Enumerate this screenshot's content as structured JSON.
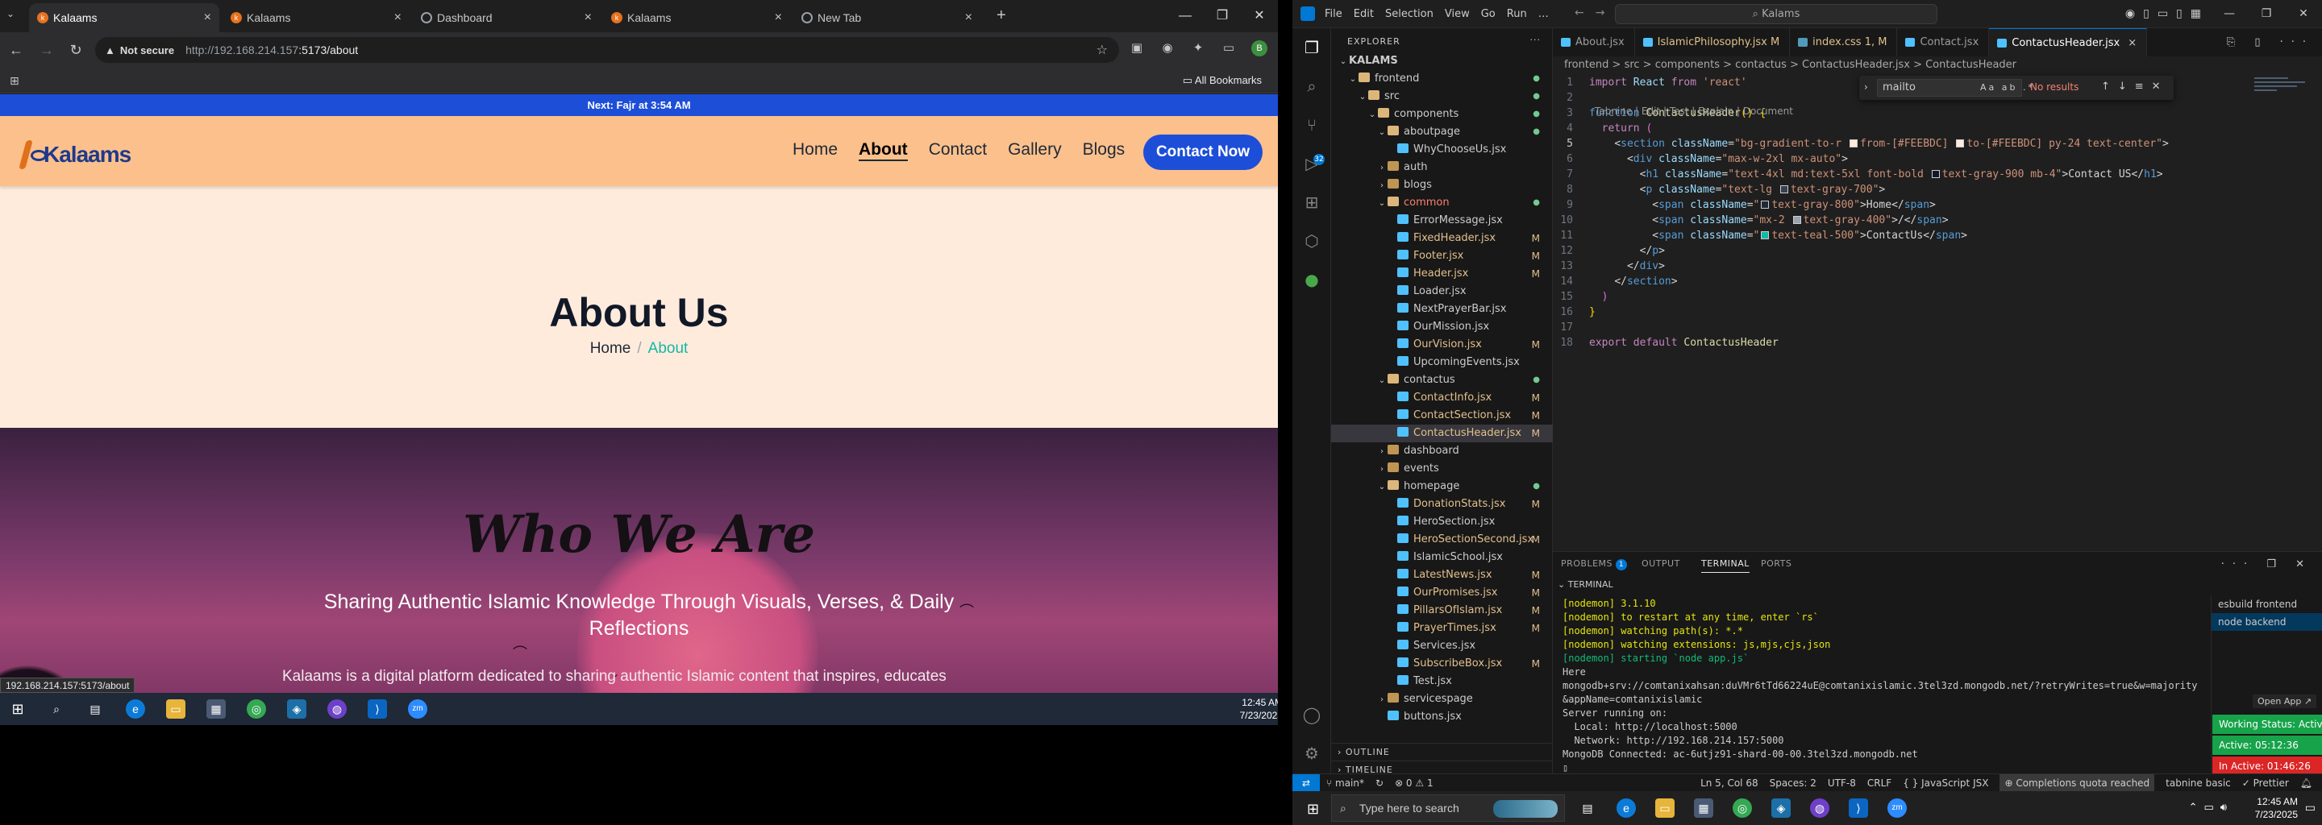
{
  "chrome": {
    "tabs": [
      {
        "title": "Kalaams",
        "active": true
      },
      {
        "title": "Kalaams"
      },
      {
        "title": "Dashboard"
      },
      {
        "title": "Kalaams"
      },
      {
        "title": "New Tab"
      }
    ],
    "new_tab": "+",
    "address": {
      "security": "Not secure",
      "url_host": "http://192.168.214.157",
      "url_path": ":5173/about"
    },
    "bookmarks_label": "All Bookmarks",
    "hover_link": "192.168.214.157:5173/about"
  },
  "site": {
    "banner": "Next: Fajr at 3:54 AM",
    "logo": "Kalaams",
    "nav": [
      {
        "label": "Home"
      },
      {
        "label": "About",
        "active": true
      },
      {
        "label": "Contact"
      },
      {
        "label": "Gallery"
      },
      {
        "label": "Blogs"
      }
    ],
    "cta": "Contact Now",
    "header": {
      "title": "About Us",
      "crumb_home": "Home",
      "crumb_sep": "/",
      "crumb_current": "About"
    },
    "who": {
      "title": "Who We Are",
      "subtitle": "Sharing Authentic Islamic Knowledge Through Visuals, Verses, & Daily Reflections",
      "paragraph": "Kalaams is a digital platform dedicated to sharing authentic Islamic content that inspires, educates"
    }
  },
  "taskbar_left": {
    "time": "12:45 AM",
    "date": "7/23/2025"
  },
  "vscode": {
    "menu": [
      "File",
      "Edit",
      "Selection",
      "View",
      "Go",
      "Run",
      "…"
    ],
    "search": "Kalams",
    "explorer_title": "EXPLORER",
    "tree": [
      {
        "label": "KALAMS",
        "kind": "root",
        "depth": 0
      },
      {
        "label": "frontend",
        "kind": "folderopen",
        "depth": 1,
        "status": "dot"
      },
      {
        "label": "src",
        "kind": "folderopen",
        "depth": 2,
        "status": "dot"
      },
      {
        "label": "components",
        "kind": "folderopen",
        "depth": 3,
        "status": "dot"
      },
      {
        "label": "aboutpage",
        "kind": "folderopen",
        "depth": 4,
        "status": "dot"
      },
      {
        "label": "WhyChooseUs.jsx",
        "kind": "jsx",
        "depth": 5
      },
      {
        "label": "auth",
        "kind": "folder",
        "depth": 4
      },
      {
        "label": "blogs",
        "kind": "folder",
        "depth": 4
      },
      {
        "label": "common",
        "kind": "folderopen",
        "depth": 4,
        "status": "dot",
        "color": "err"
      },
      {
        "label": "ErrorMessage.jsx",
        "kind": "jsx",
        "depth": 5
      },
      {
        "label": "FixedHeader.jsx",
        "kind": "jsx",
        "depth": 5,
        "status": "M",
        "color": "mod"
      },
      {
        "label": "Footer.jsx",
        "kind": "jsx",
        "depth": 5,
        "status": "M",
        "color": "mod"
      },
      {
        "label": "Header.jsx",
        "kind": "jsx",
        "depth": 5,
        "status": "M",
        "color": "mod"
      },
      {
        "label": "Loader.jsx",
        "kind": "jsx",
        "depth": 5
      },
      {
        "label": "NextPrayerBar.jsx",
        "kind": "jsx",
        "depth": 5
      },
      {
        "label": "OurMission.jsx",
        "kind": "jsx",
        "depth": 5
      },
      {
        "label": "OurVision.jsx",
        "kind": "jsx",
        "depth": 5,
        "status": "M",
        "color": "mod"
      },
      {
        "label": "UpcomingEvents.jsx",
        "kind": "jsx",
        "depth": 5
      },
      {
        "label": "contactus",
        "kind": "folderopen",
        "depth": 4,
        "status": "dot"
      },
      {
        "label": "ContactInfo.jsx",
        "kind": "jsx",
        "depth": 5,
        "status": "M",
        "color": "mod"
      },
      {
        "label": "ContactSection.jsx",
        "kind": "jsx",
        "depth": 5,
        "status": "M",
        "color": "mod"
      },
      {
        "label": "ContactusHeader.jsx",
        "kind": "jsx",
        "depth": 5,
        "status": "M",
        "color": "mod",
        "selected": true
      },
      {
        "label": "dashboard",
        "kind": "folder",
        "depth": 4
      },
      {
        "label": "events",
        "kind": "folder",
        "depth": 4
      },
      {
        "label": "homepage",
        "kind": "folderopen",
        "depth": 4,
        "status": "dot"
      },
      {
        "label": "DonationStats.jsx",
        "kind": "jsx",
        "depth": 5,
        "status": "M",
        "color": "mod"
      },
      {
        "label": "HeroSection.jsx",
        "kind": "jsx",
        "depth": 5
      },
      {
        "label": "HeroSectionSecond.jsx",
        "kind": "jsx",
        "depth": 5,
        "status": "M",
        "color": "mod"
      },
      {
        "label": "IslamicSchool.jsx",
        "kind": "jsx",
        "depth": 5
      },
      {
        "label": "LatestNews.jsx",
        "kind": "jsx",
        "depth": 5,
        "status": "M",
        "color": "mod"
      },
      {
        "label": "OurPromises.jsx",
        "kind": "jsx",
        "depth": 5,
        "status": "M",
        "color": "mod"
      },
      {
        "label": "PillarsOfIslam.jsx",
        "kind": "jsx",
        "depth": 5,
        "status": "M",
        "color": "mod"
      },
      {
        "label": "PrayerTimes.jsx",
        "kind": "jsx",
        "depth": 5,
        "status": "M",
        "color": "mod"
      },
      {
        "label": "Services.jsx",
        "kind": "jsx",
        "depth": 5
      },
      {
        "label": "SubscribeBox.jsx",
        "kind": "jsx",
        "depth": 5,
        "status": "M",
        "color": "mod"
      },
      {
        "label": "Test.jsx",
        "kind": "jsx",
        "depth": 5
      },
      {
        "label": "servicespage",
        "kind": "folder",
        "depth": 4
      },
      {
        "label": "buttons.jsx",
        "kind": "jsx",
        "depth": 4
      }
    ],
    "outline": "OUTLINE",
    "timeline": "TIMELINE",
    "editor_tabs": [
      {
        "label": "About.jsx"
      },
      {
        "label": "IslamicPhilosophy.jsx",
        "suffix": "M",
        "mod": true
      },
      {
        "label": "index.css",
        "suffix": "1, M",
        "mod": true
      },
      {
        "label": "Contact.jsx"
      },
      {
        "label": "ContactusHeader.jsx",
        "active": true
      }
    ],
    "breadcrumb": "frontend > src > components > contactus > ContactusHeader.jsx > ContactusHeader",
    "codelens": "Tabnine | Edit | Test | Explain | Document",
    "find": {
      "query": "mailto",
      "result": "No results",
      "opts": "Aa ab .*"
    },
    "panel_tabs": [
      {
        "label": "PROBLEMS",
        "badge": "1"
      },
      {
        "label": "OUTPUT"
      },
      {
        "label": "TERMINAL",
        "active": true
      },
      {
        "label": "PORTS"
      }
    ],
    "terminal_header": "TERMINAL",
    "terminal_lines": [
      {
        "t": "[nodemon] 3.1.10",
        "c": "tg"
      },
      {
        "t": "[nodemon] to restart at any time, enter `rs`",
        "c": "tg"
      },
      {
        "t": "[nodemon] watching path(s): *.*",
        "c": "tg"
      },
      {
        "t": "[nodemon] watching extensions: js,mjs,cjs,json",
        "c": "tg"
      },
      {
        "t": "[nodemon] starting `node app.js`",
        "c": "tgreen"
      },
      {
        "t": "Here",
        "c": ""
      },
      {
        "t": "mongodb+srv://comtanixahsan:duVMr6tTd66224uE@comtanixislamic.3tel3zd.mongodb.net/?retryWrites=true&w=majority",
        "c": ""
      },
      {
        "t": "&appName=comtanixislamic",
        "c": ""
      },
      {
        "t": "Server running on:",
        "c": ""
      },
      {
        "t": "  Local: http://localhost:5000",
        "c": ""
      },
      {
        "t": "  Network: http://192.168.214.157:5000",
        "c": ""
      },
      {
        "t": "MongoDB Connected: ac-6utjz91-shard-00-00.3tel3zd.mongodb.net",
        "c": ""
      }
    ],
    "term_list": [
      {
        "label": "esbuild  frontend"
      },
      {
        "label": "node  backend",
        "active": true
      }
    ],
    "open_app": "Open App ↗",
    "work_status": [
      {
        "label": "Working Status: Active",
        "color": "#16a34a"
      },
      {
        "label": "Active: 05:12:36",
        "color": "#16a34a"
      },
      {
        "label": "In Active: 01:46:26",
        "color": "#dc2626"
      }
    ],
    "status": {
      "branch": "main*",
      "problems": "⊗ 0 ⚠ 1",
      "position": "Ln 5, Col 68",
      "spaces": "Spaces: 2",
      "encoding": "UTF-8",
      "eol": "CRLF",
      "lang": "{ } JavaScript JSX",
      "tabnine_quota": "Completions quota reached",
      "tabnine": "tabnine basic",
      "prettier": "✓ Prettier"
    }
  },
  "taskbar_right": {
    "search": "Type here to search",
    "time": "12:45 AM",
    "date": "7/23/2025"
  }
}
